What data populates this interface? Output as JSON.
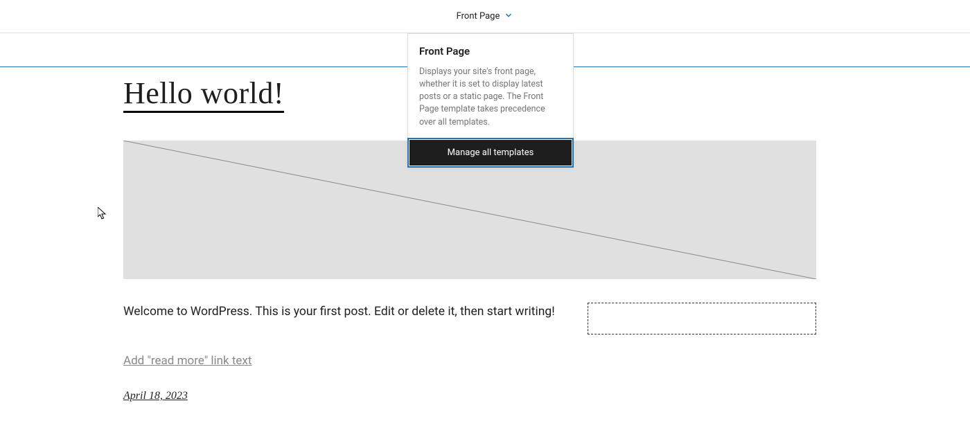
{
  "toolbar": {
    "template_label": "Front Page"
  },
  "dropdown": {
    "title": "Front Page",
    "description": "Displays your site's front page, whether it is set to display latest posts or a static page. The Front Page template takes precedence over all templates.",
    "action": "Manage all templates"
  },
  "post": {
    "title": "Hello world!",
    "excerpt": "Welcome to WordPress. This is your first post. Edit or delete it, then start writing!",
    "read_more_placeholder": "Add \"read more\" link text",
    "date": "April 18, 2023"
  }
}
